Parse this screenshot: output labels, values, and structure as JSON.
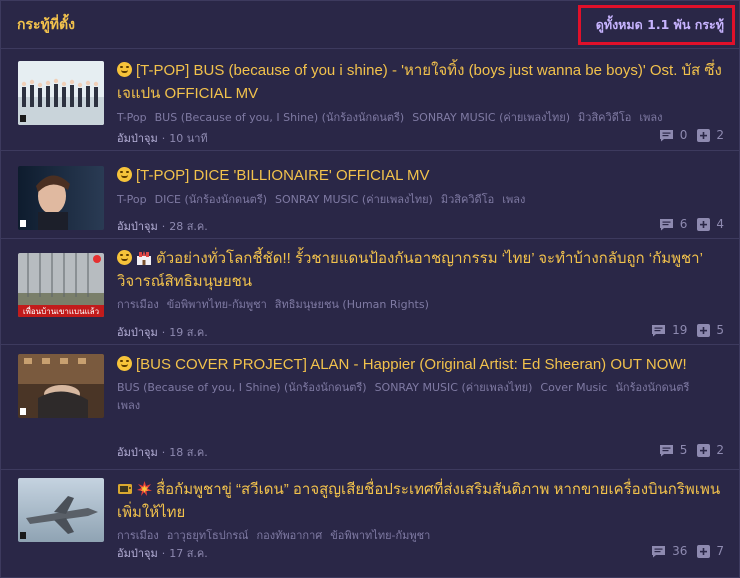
{
  "header": {
    "title": "กระทู้ที่ตั้ง",
    "view_all": "ดูทั้งหมด 1.1 พัน กระทู้"
  },
  "topics": [
    {
      "title": "[T-POP] BUS (because of you i shine) - 'หายใจทิ้ง (boys just wanna be boys)' Ost. บัส ซึ่ง เจแปน OFFICIAL MV",
      "icons": [
        "smile-emoji"
      ],
      "tags": [
        "T-Pop",
        "BUS (Because of you, I Shine) (นักร้องนักดนตรี)",
        "SONRAY MUSIC (ค่ายเพลงไทย)",
        "มิวสิควิดีโอ",
        "เพลง"
      ],
      "author": "อัมป่าจุม",
      "time": "10 นาที",
      "comments": "0",
      "votes": "2"
    },
    {
      "title": "[T-POP] DICE 'BILLIONAIRE' OFFICIAL MV",
      "icons": [
        "smile-emoji"
      ],
      "tags": [
        "T-Pop",
        "DICE (นักร้องนักดนตรี)",
        "SONRAY MUSIC (ค่ายเพลงไทย)",
        "มิวสิควิดีโอ",
        "เพลง"
      ],
      "author": "อัมป่าจุม",
      "time": "28 ส.ค.",
      "comments": "6",
      "votes": "4"
    },
    {
      "title": "ตัวอย่างทั่วโลกชี้ชัด!! รั้วชายแดนป้องกันอาชญากรรม ‘ไทย’ จะทำบ้างกลับถูก ‘กัมพูชา’ วิจารณ์สิทธิมนุษยชน",
      "icons": [
        "smile-emoji",
        "castle-emoji"
      ],
      "tags": [
        "การเมือง",
        "ข้อพิพาทไทย-กัมพูชา",
        "สิทธิมนุษยชน (Human Rights)"
      ],
      "author": "อัมป่าจุม",
      "time": "19 ส.ค.",
      "comments": "19",
      "votes": "5"
    },
    {
      "title": "[BUS COVER PROJECT] ALAN - Happier (Original Artist: Ed Sheeran) OUT NOW!",
      "icons": [
        "smile-emoji"
      ],
      "tags": [
        "BUS (Because of you, I Shine) (นักร้องนักดนตรี)",
        "SONRAY MUSIC (ค่ายเพลงไทย)",
        "Cover Music",
        "นักร้องนักดนตรี",
        "เพลง"
      ],
      "author": "อัมป่าจุม",
      "time": "18 ส.ค.",
      "comments": "5",
      "votes": "2"
    },
    {
      "title": "สื่อกัมพูชาขู่ “สวีเดน” อาจสูญเสียชื่อประเทศที่ส่งเสริมสันติภาพ หากขายเครื่องบินกริพเพนเพิ่มให้ไทย",
      "icons": [
        "tv-emoji",
        "boom-emoji"
      ],
      "tags": [
        "การเมือง",
        "อาวุธยุทโธปกรณ์",
        "กองทัพอากาศ",
        "ข้อพิพาทไทย-กัมพูชา"
      ],
      "author": "อัมป่าจุม",
      "time": "17 ส.ค.",
      "comments": "36",
      "votes": "7"
    }
  ],
  "thumb3_caption": "เพื่อนบ้านเขาแบนแล้ว"
}
